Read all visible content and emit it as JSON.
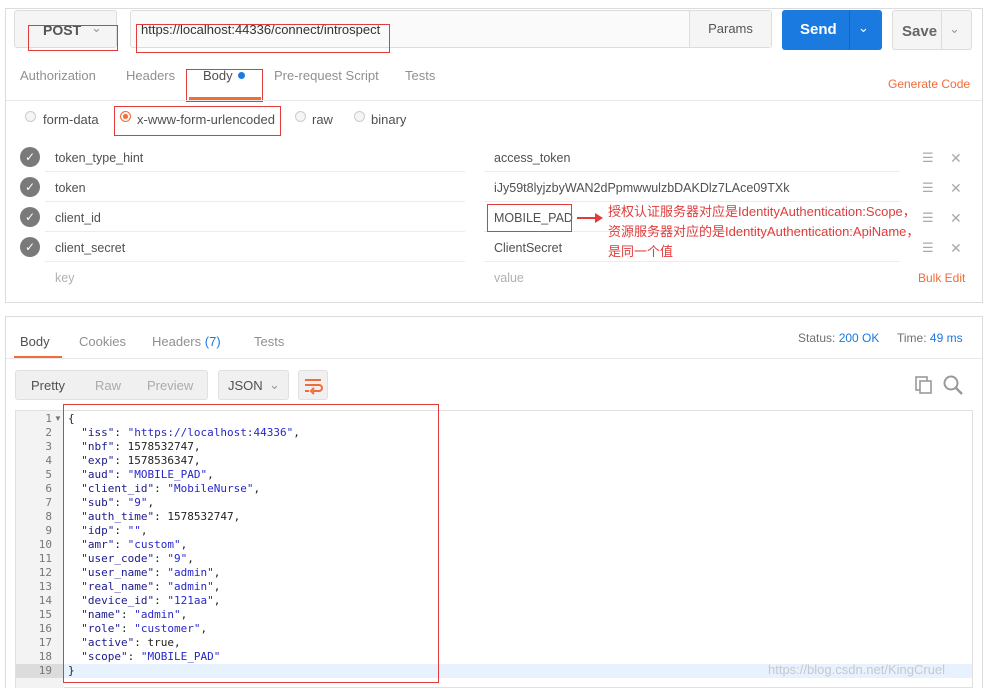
{
  "request": {
    "method": "POST",
    "url": "https://localhost:44336/connect/introspect",
    "params_label": "Params",
    "send_label": "Send",
    "save_label": "Save",
    "tabs": [
      "Authorization",
      "Headers",
      "Body",
      "Pre-request Script",
      "Tests"
    ],
    "active_tab": "Body",
    "generate_code": "Generate Code",
    "body_types": [
      "form-data",
      "x-www-form-urlencoded",
      "raw",
      "binary"
    ],
    "selected_body_type": "x-www-form-urlencoded",
    "rows": [
      {
        "key": "token_type_hint",
        "value": "access_token",
        "enabled": true
      },
      {
        "key": "token",
        "value": "iJy59t8lyjzbyWAN2dPpmwwulzbDAKDlz7LAce09TXk",
        "enabled": true
      },
      {
        "key": "client_id",
        "value": "MOBILE_PAD",
        "enabled": true
      },
      {
        "key": "client_secret",
        "value": "ClientSecret",
        "enabled": true
      }
    ],
    "key_placeholder": "key",
    "value_placeholder": "value",
    "bulk_edit": "Bulk Edit"
  },
  "annotation": {
    "lines": [
      "授权认证服务器对应是IdentityAuthentication:Scope，",
      "资源服务器对应的是IdentityAuthentication:ApiName，",
      "是同一个值"
    ],
    "color": "#e03c3c"
  },
  "response": {
    "tabs": [
      "Body",
      "Cookies",
      "Headers",
      "Tests"
    ],
    "headers_count": "(7)",
    "active_tab": "Body",
    "status_label": "Status:",
    "status_value": "200 OK",
    "time_label": "Time:",
    "time_value": "49 ms",
    "formats": [
      "Pretty",
      "Raw",
      "Preview"
    ],
    "active_format": "Pretty",
    "language": "JSON",
    "code_lines": [
      "{",
      "  \"iss\": \"https://localhost:44336\",",
      "  \"nbf\": 1578532747,",
      "  \"exp\": 1578536347,",
      "  \"aud\": \"MOBILE_PAD\",",
      "  \"client_id\": \"MobileNurse\",",
      "  \"sub\": \"9\",",
      "  \"auth_time\": 1578532747,",
      "  \"idp\": \"\",",
      "  \"amr\": \"custom\",",
      "  \"user_code\": \"9\",",
      "  \"user_name\": \"admin\",",
      "  \"real_name\": \"admin\",",
      "  \"device_id\": \"121aa\",",
      "  \"name\": \"admin\",",
      "  \"role\": \"customer\",",
      "  \"active\": true,",
      "  \"scope\": \"MOBILE_PAD\"",
      "}"
    ]
  },
  "watermark": "https://blog.csdn.net/KingCruel",
  "colors": {
    "accent": "#f26b3a",
    "send": "#1a7ae0",
    "annotation_red": "#e03c3c"
  }
}
